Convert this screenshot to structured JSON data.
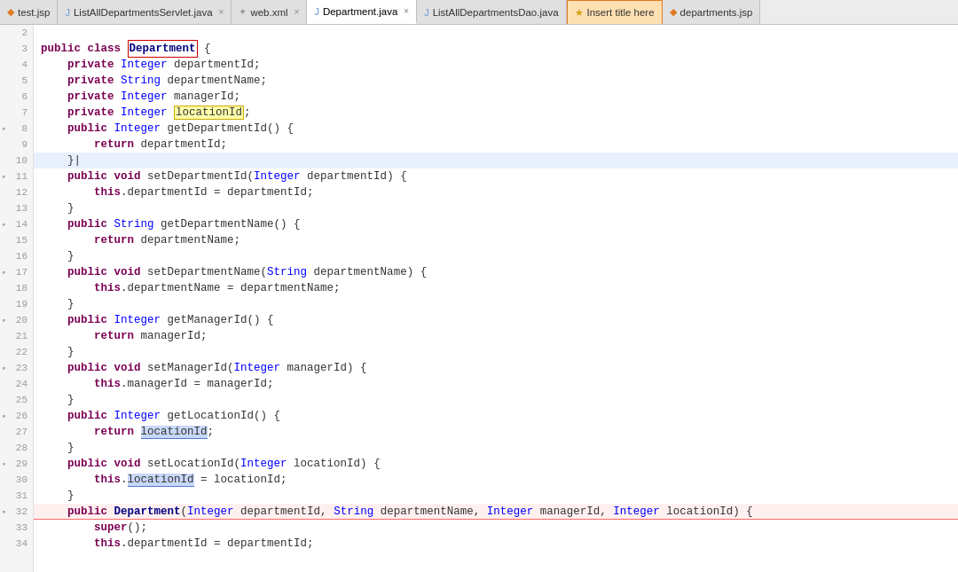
{
  "tabs": [
    {
      "id": "test-jsp",
      "label": "test.jsp",
      "icon": "jsp",
      "active": false,
      "closable": false
    },
    {
      "id": "listall-servlet",
      "label": "ListAllDepartmentsServlet.java",
      "icon": "java",
      "active": false,
      "closable": true
    },
    {
      "id": "web-xml",
      "label": "web.xml",
      "icon": "xml",
      "active": false,
      "closable": true
    },
    {
      "id": "department-java",
      "label": "Department.java",
      "icon": "java",
      "active": true,
      "closable": true
    },
    {
      "id": "listall-dao",
      "label": "ListAllDepartmentsDao.java",
      "icon": "java",
      "active": false,
      "closable": false
    },
    {
      "id": "insert-title",
      "label": "Insert title here",
      "icon": "title",
      "active": false,
      "closable": false
    },
    {
      "id": "departments-jsp",
      "label": "departments.jsp",
      "icon": "jsp",
      "active": false,
      "closable": false
    }
  ],
  "code": {
    "lines": [
      {
        "num": "2",
        "fold": false,
        "content": ""
      },
      {
        "num": "3",
        "fold": false,
        "content": "public class Department {"
      },
      {
        "num": "4",
        "fold": false,
        "content": "\tprivate Integer departmentId;"
      },
      {
        "num": "5",
        "fold": false,
        "content": "\tprivate String departmentName;"
      },
      {
        "num": "6",
        "fold": false,
        "content": "\tprivate Integer managerId;"
      },
      {
        "num": "7",
        "fold": false,
        "content": "\tprivate Integer locationId;"
      },
      {
        "num": "8",
        "fold": true,
        "content": "\tpublic Integer getDepartmentId() {"
      },
      {
        "num": "9",
        "fold": false,
        "content": "\t\treturn departmentId;"
      },
      {
        "num": "10",
        "fold": false,
        "content": "\t}"
      },
      {
        "num": "11",
        "fold": true,
        "content": "\tpublic void setDepartmentId(Integer departmentId) {"
      },
      {
        "num": "12",
        "fold": false,
        "content": "\t\tthis.departmentId = departmentId;"
      },
      {
        "num": "13",
        "fold": false,
        "content": "\t}"
      },
      {
        "num": "14",
        "fold": true,
        "content": "\tpublic String getDepartmentName() {"
      },
      {
        "num": "15",
        "fold": false,
        "content": "\t\treturn departmentName;"
      },
      {
        "num": "16",
        "fold": false,
        "content": "\t}"
      },
      {
        "num": "17",
        "fold": true,
        "content": "\tpublic void setDepartmentName(String departmentName) {"
      },
      {
        "num": "18",
        "fold": false,
        "content": "\t\tthis.departmentName = departmentName;"
      },
      {
        "num": "19",
        "fold": false,
        "content": "\t}"
      },
      {
        "num": "20",
        "fold": true,
        "content": "\tpublic Integer getManagerId() {"
      },
      {
        "num": "21",
        "fold": false,
        "content": "\t\treturn managerId;"
      },
      {
        "num": "22",
        "fold": false,
        "content": "\t}"
      },
      {
        "num": "23",
        "fold": true,
        "content": "\tpublic void setManagerId(Integer managerId) {"
      },
      {
        "num": "24",
        "fold": false,
        "content": "\t\tthis.managerId = managerId;"
      },
      {
        "num": "25",
        "fold": false,
        "content": "\t}"
      },
      {
        "num": "26",
        "fold": true,
        "content": "\tpublic Integer getLocationId() {"
      },
      {
        "num": "27",
        "fold": false,
        "content": "\t\treturn locationId;"
      },
      {
        "num": "28",
        "fold": false,
        "content": "\t}"
      },
      {
        "num": "29",
        "fold": true,
        "content": "\tpublic void setLocationId(Integer locationId) {"
      },
      {
        "num": "30",
        "fold": false,
        "content": "\t\tthis.locationId = locationId;"
      },
      {
        "num": "31",
        "fold": false,
        "content": "\t}"
      },
      {
        "num": "32",
        "fold": true,
        "content": "\tpublic Department(Integer departmentId, String departmentName, Integer managerId, Integer locationId) {"
      },
      {
        "num": "33",
        "fold": false,
        "content": "\t\tsuper();"
      },
      {
        "num": "34",
        "fold": false,
        "content": "\t\tthis.departmentId = departmentId;"
      }
    ]
  }
}
